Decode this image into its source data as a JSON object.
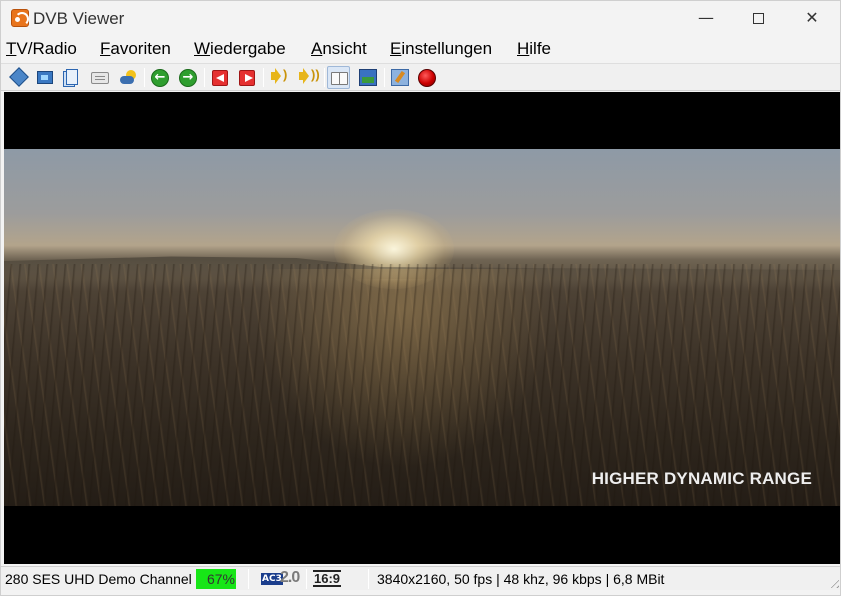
{
  "window": {
    "title": "DVB Viewer",
    "minimize_symbol": "—",
    "close_symbol": "✕"
  },
  "menu": [
    {
      "accel": "T",
      "rest": "V/Radio"
    },
    {
      "accel": "F",
      "rest": "avoriten"
    },
    {
      "accel": "W",
      "rest": "iedergabe"
    },
    {
      "accel": "A",
      "rest": "nsicht"
    },
    {
      "accel": "E",
      "rest": "instellungen"
    },
    {
      "accel": "H",
      "rest": "ilfe"
    }
  ],
  "toolbar": {
    "icons": [
      "channel-list-icon",
      "fullscreen-icon",
      "pages-icon",
      "teletext-icon",
      "weather-epg-icon",
      "previous-channel-icon",
      "next-channel-icon",
      "stop-left-icon",
      "stop-right-icon",
      "volume-down-icon",
      "volume-up-icon",
      "epg-book-icon",
      "picture-icon",
      "settings-icon",
      "record-icon"
    ],
    "prev_arrow": "←",
    "next_arrow": "→"
  },
  "video": {
    "caption": "HIGHER DYNAMIC RANGE"
  },
  "statusbar": {
    "channel": "280 SES UHD Demo Channel (",
    "signal_label": "67%",
    "signal_level": 0.67,
    "signal_color": "#17e617",
    "audio_codec": "AC3",
    "audio_channels": "2.0",
    "aspect": "16:9",
    "stream_info": "3840x2160, 50 fps | 48 khz, 96 kbps | 6,8 MBit"
  }
}
